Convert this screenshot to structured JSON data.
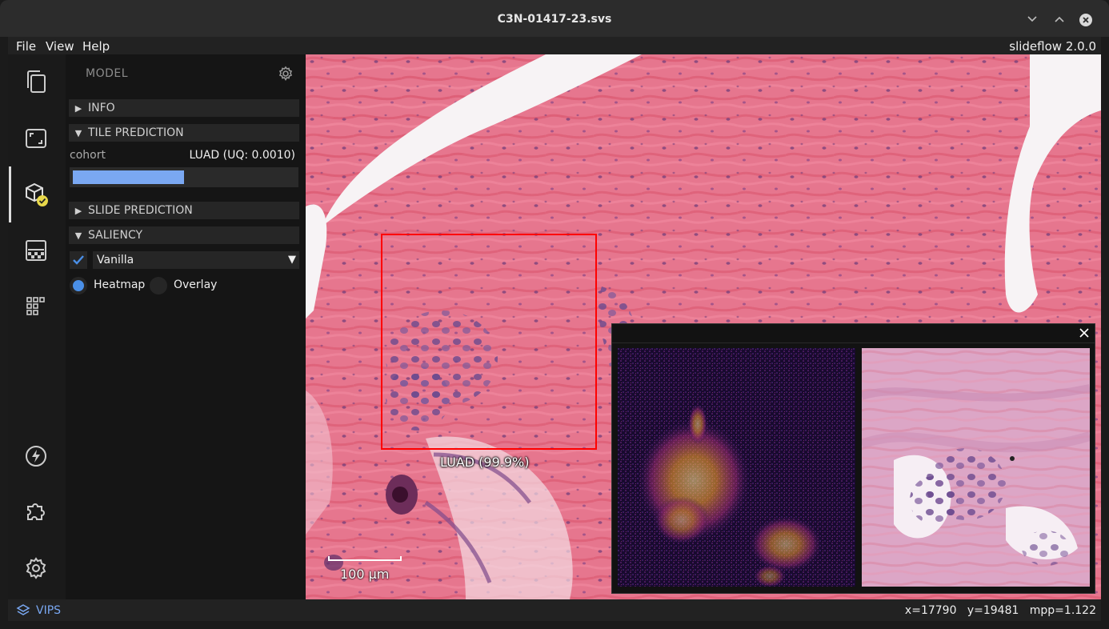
{
  "window": {
    "title": "C3N-01417-23.svs"
  },
  "menu": {
    "items": [
      "File",
      "View",
      "Help"
    ],
    "version": "slideflow 2.0.0"
  },
  "panel": {
    "title": "MODEL",
    "sections": {
      "info": "INFO",
      "tile_prediction": "TILE PREDICTION",
      "slide_prediction": "SLIDE PREDICTION",
      "saliency": "SALIENCY"
    },
    "tile_prediction": {
      "outcome_label": "cohort",
      "value": "LUAD (UQ: 0.0010)",
      "bar_fraction": 0.5
    },
    "saliency": {
      "enabled": true,
      "method": "Vanilla",
      "options": [
        "Heatmap",
        "Overlay"
      ],
      "selected": "Heatmap"
    }
  },
  "viewer": {
    "prediction_label": "LUAD (99.9%)",
    "scale_label": "100 µm"
  },
  "status": {
    "backend": "VIPS",
    "x": "x=17790",
    "y": "y=19481",
    "mpp": "mpp=1.122"
  },
  "colors": {
    "accent": "#7aa8f2",
    "roi": "#ff0000",
    "radio_selected": "#4a8fe7"
  },
  "icons": [
    "copy-icon",
    "fullscreen-icon",
    "model-icon",
    "heatmap-icon",
    "grid-icon",
    "bolt-icon",
    "puzzle-icon",
    "settings-icon"
  ]
}
